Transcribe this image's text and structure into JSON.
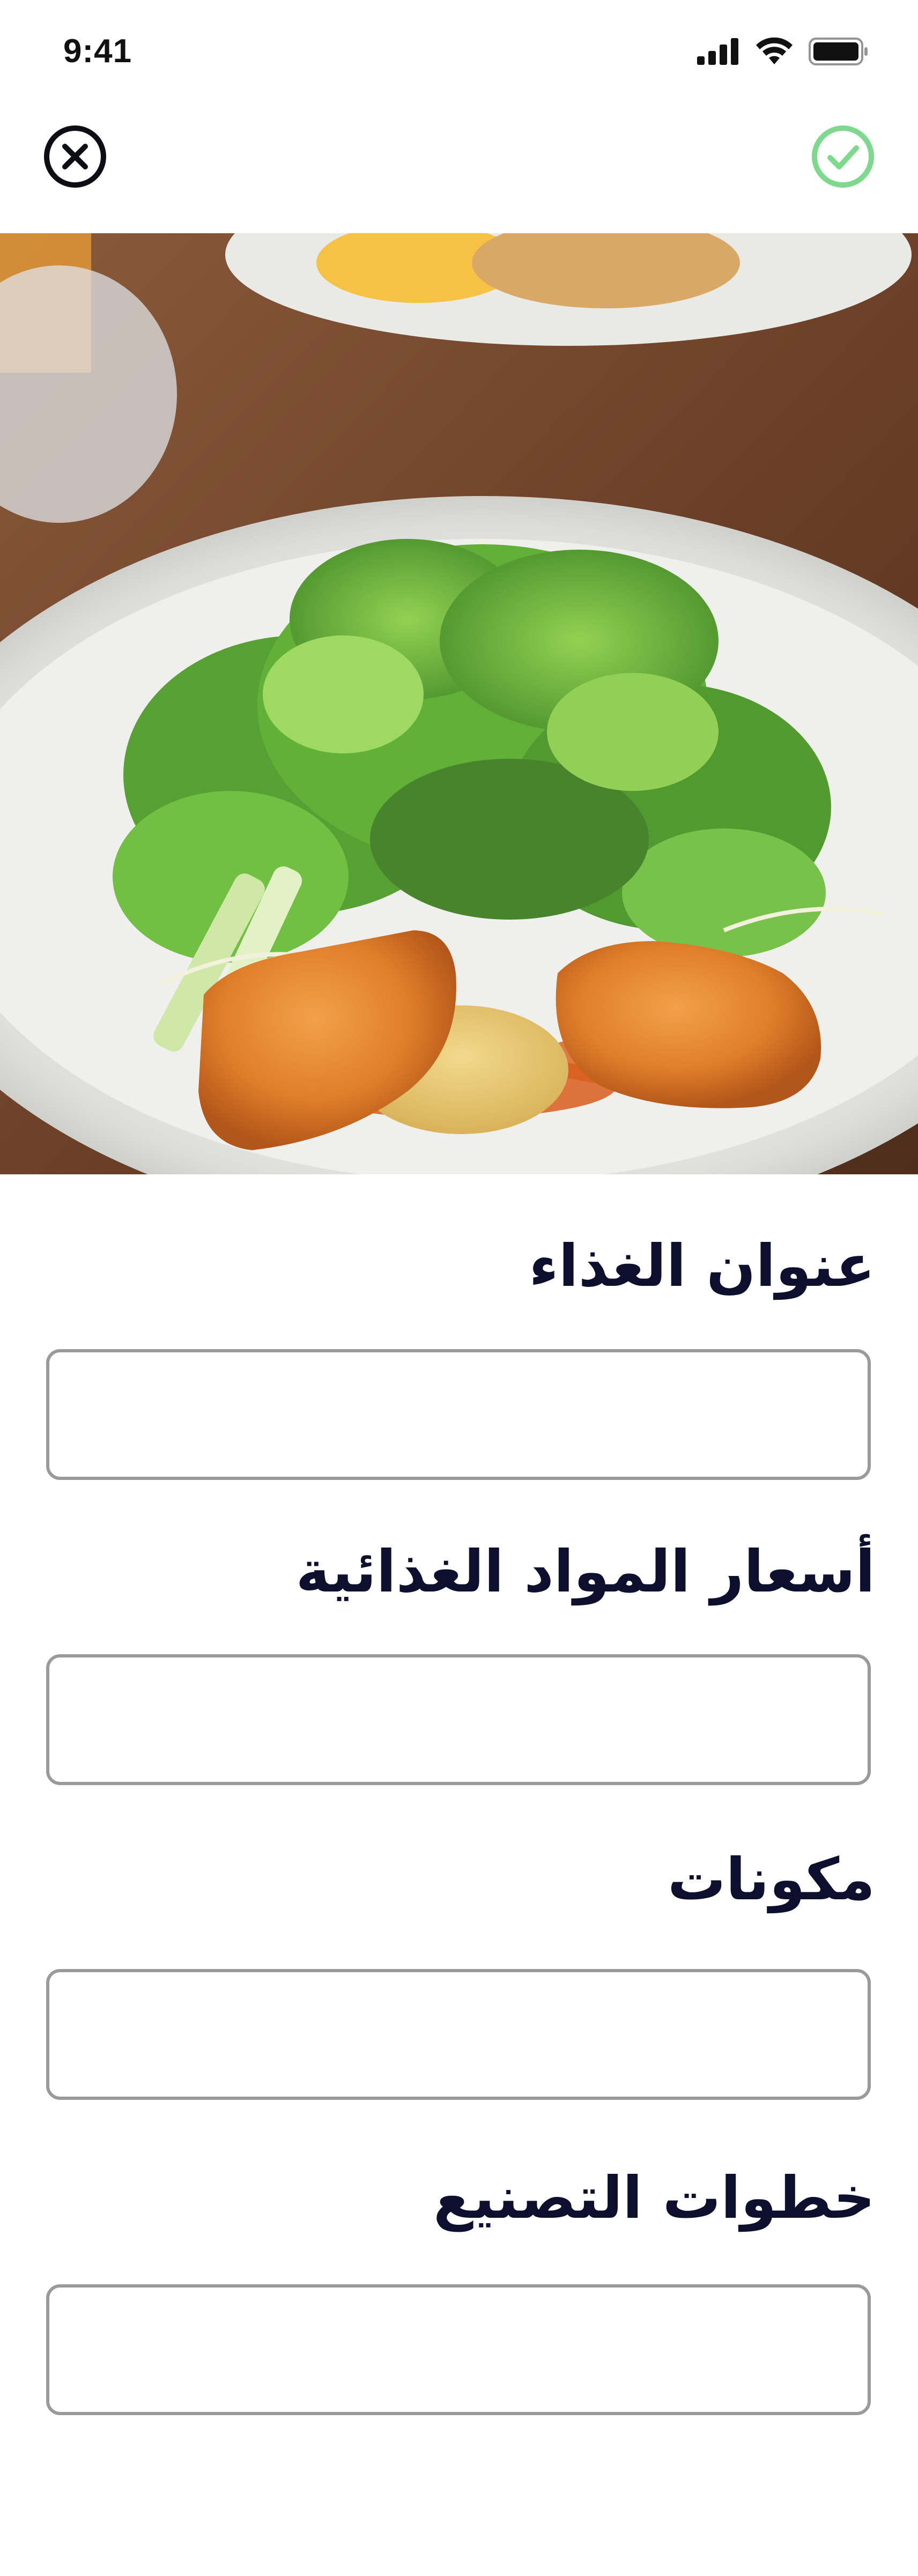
{
  "status_bar": {
    "time": "9:41"
  },
  "nav": {
    "close_icon": "close-circle-icon",
    "confirm_icon": "check-circle-icon",
    "confirm_color": "#7ed98e"
  },
  "hero": {
    "image_alt": "salad with fried croquettes on white plate"
  },
  "form": {
    "fields": [
      {
        "label": "عنوان الغذاء",
        "value": "",
        "placeholder": ""
      },
      {
        "label": "أسعار المواد الغذائية",
        "value": "",
        "placeholder": ""
      },
      {
        "label": "مكونات",
        "value": "",
        "placeholder": ""
      },
      {
        "label": "خطوات التصنيع",
        "value": "",
        "placeholder": ""
      }
    ]
  },
  "colors": {
    "text": "#0d0f2e",
    "border": "#9a9a9a",
    "accent": "#7ed98e",
    "background": "#ffffff"
  }
}
